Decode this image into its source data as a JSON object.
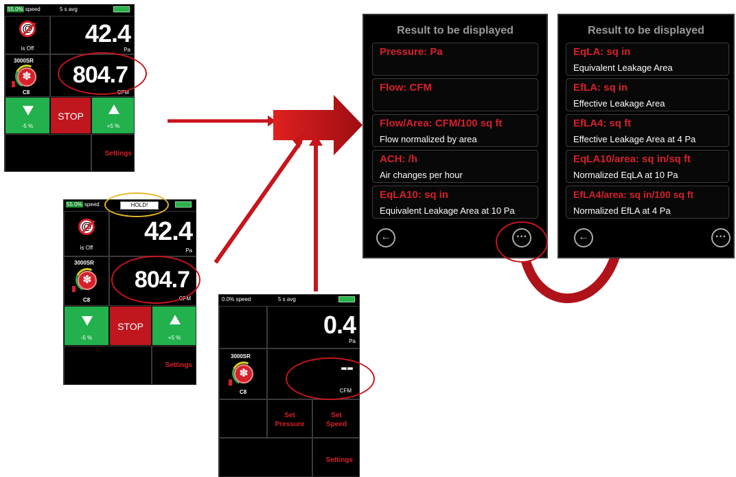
{
  "screen_a": {
    "speed_pct": "55.0%",
    "speed_label": "speed",
    "avg_label": "5 s avg",
    "device_status": "is Off",
    "pressure_value": "42.4",
    "pressure_unit": "Pa",
    "fan_model": "3000SR",
    "fan_ring": "C8",
    "flow_value": "804.7",
    "flow_unit": "CFM",
    "down_label": "-5 %",
    "stop_label": "STOP",
    "up_label": "+5 %",
    "settings_label": "Settings"
  },
  "screen_b": {
    "speed_pct": "55.0%",
    "speed_label": "speed",
    "hold_label": "HOLD!",
    "device_status": "is Off",
    "pressure_value": "42.4",
    "pressure_unit": "Pa",
    "fan_model": "3000SR",
    "fan_ring": "C8",
    "flow_value": "804.7",
    "flow_unit": "CFM",
    "down_label": "-5 %",
    "stop_label": "STOP",
    "up_label": "+5 %",
    "settings_label": "Settings"
  },
  "screen_c": {
    "speed_label": "0.0% speed",
    "avg_label": "5 s avg",
    "pressure_value": "0.4",
    "pressure_unit": "Pa",
    "fan_model": "3000SR",
    "fan_ring": "C8",
    "flow_value": "--",
    "flow_unit": "CFM",
    "set_pressure_label": "Set\nPressure",
    "set_speed_label": "Set\nSpeed",
    "settings_label": "Settings"
  },
  "panel_left": {
    "title": "Result to be displayed",
    "options": [
      {
        "title": "Pressure: Pa",
        "desc": ""
      },
      {
        "title": "Flow: CFM",
        "desc": ""
      },
      {
        "title": "Flow/Area: CFM/100 sq ft",
        "desc": "Flow normalized by area"
      },
      {
        "title": "ACH: /h",
        "desc": "Air changes per hour"
      },
      {
        "title": "EqLA10: sq in",
        "desc": "Equivalent Leakage Area at 10 Pa"
      }
    ],
    "back_icon": "←",
    "more_icon": "···"
  },
  "panel_right": {
    "title": "Result to be displayed",
    "options": [
      {
        "title": "EqLA: sq in",
        "desc": "Equivalent Leakage Area"
      },
      {
        "title": "EfLA: sq in",
        "desc": "Effective Leakage Area"
      },
      {
        "title": "EfLA4: sq ft",
        "desc": "Effective Leakage Area at 4 Pa"
      },
      {
        "title": "EqLA10/area: sq in/sq ft",
        "desc": "Normalized EqLA at 10 Pa"
      },
      {
        "title": "EfLA4/area: sq in/100 sq ft",
        "desc": "Normalized EfLA at 4 Pa"
      }
    ],
    "back_icon": "←",
    "more_icon": "···"
  },
  "colors": {
    "accent_red": "#d6202a",
    "button_green": "#22b14c",
    "annotation_red": "#c8141c",
    "annotation_yellow": "#e6b722"
  }
}
